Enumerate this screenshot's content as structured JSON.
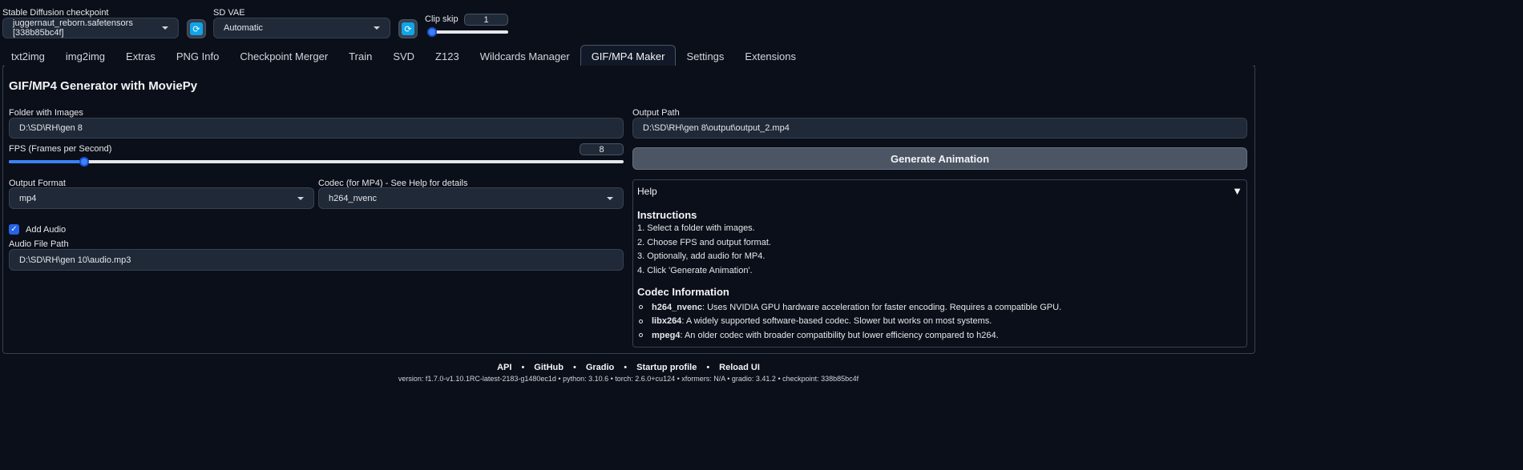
{
  "top": {
    "checkpoint_label": "Stable Diffusion checkpoint",
    "checkpoint_value": "juggernaut_reborn.safetensors [338b85bc4f]",
    "vae_label": "SD VAE",
    "vae_value": "Automatic",
    "clip_skip_label": "Clip skip",
    "clip_skip_value": "1",
    "clip_skip_fraction": 0.0
  },
  "tabs": [
    {
      "label": "txt2img"
    },
    {
      "label": "img2img"
    },
    {
      "label": "Extras"
    },
    {
      "label": "PNG Info"
    },
    {
      "label": "Checkpoint Merger"
    },
    {
      "label": "Train"
    },
    {
      "label": "SVD"
    },
    {
      "label": "Z123"
    },
    {
      "label": "Wildcards Manager"
    },
    {
      "label": "GIF/MP4 Maker",
      "active": true
    },
    {
      "label": "Settings"
    },
    {
      "label": "Extensions"
    }
  ],
  "main": {
    "title": "GIF/MP4 Generator with MoviePy",
    "folder_label": "Folder with Images",
    "folder_value": "D:\\SD\\RH\\gen 8",
    "fps_label": "FPS (Frames per Second)",
    "fps_value": "8",
    "fps_fraction": 0.123,
    "format_label": "Output Format",
    "format_value": "mp4",
    "codec_label": "Codec (for MP4) - See Help for details",
    "codec_value": "h264_nvenc",
    "add_audio_label": "Add Audio",
    "add_audio_checked": true,
    "audio_label": "Audio File Path",
    "audio_value": "D:\\SD\\RH\\gen 10\\audio.mp3",
    "output_label": "Output Path",
    "output_value": "D:\\SD\\RH\\gen 8\\output\\output_2.mp4",
    "generate_label": "Generate Animation"
  },
  "help": {
    "title": "Help",
    "instructions_title": "Instructions",
    "steps": [
      "1. Select a folder with images.",
      "2. Choose FPS and output format.",
      "3. Optionally, add audio for MP4.",
      "4. Click 'Generate Animation'."
    ],
    "codec_title": "Codec Information",
    "codecs": [
      {
        "name": "h264_nvenc",
        "desc": ": Uses NVIDIA GPU hardware acceleration for faster encoding. Requires a compatible GPU."
      },
      {
        "name": "libx264",
        "desc": ": A widely supported software-based codec. Slower but works on most systems."
      },
      {
        "name": "mpeg4",
        "desc": ": An older codec with broader compatibility but lower efficiency compared to h264."
      }
    ]
  },
  "footer": {
    "links": [
      "API",
      "GitHub",
      "Gradio",
      "Startup profile",
      "Reload UI"
    ],
    "separator": "•",
    "version_text": "version: f1.7.0-v1.10.1RC-latest-2183-g1480ec1d  •  python: 3.10.6  •  torch: 2.6.0+cu124  •  xformers: N/A  •  gradio: 3.41.2  •  checkpoint: 338b85bc4f"
  }
}
